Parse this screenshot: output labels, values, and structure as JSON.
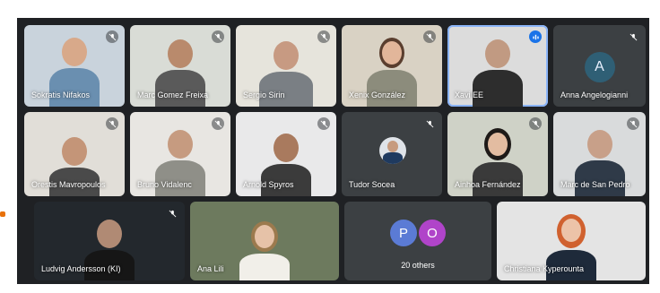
{
  "participants": [
    {
      "name": "Sokratis Nifakos"
    },
    {
      "name": "Marc Gomez Freixa"
    },
    {
      "name": "Sergio Sirin"
    },
    {
      "name": "Xenix González"
    },
    {
      "name": "Xavi EE"
    },
    {
      "name": "Anna Angelogianni",
      "initial": "A"
    },
    {
      "name": "Orestis Mavropoulos"
    },
    {
      "name": "Bruno Vidalenc"
    },
    {
      "name": "Arnold Spyros"
    },
    {
      "name": "Tudor Socea"
    },
    {
      "name": "Ainhoa Fernández"
    },
    {
      "name": "Marc de San Pedro"
    },
    {
      "name": "Ludvig Andersson (KI)"
    },
    {
      "name": "Ana Lili"
    },
    {
      "name": "Christiana Kyperounta"
    }
  ],
  "others": {
    "initials": [
      "P",
      "O"
    ],
    "label": "20 others",
    "colors": [
      "#5b7bd5",
      "#b044c9"
    ]
  },
  "colors": {
    "background": "#1f2124",
    "tile": "#3c4043",
    "speaking_border": "#8ab4f8",
    "active_mic": "#1a73e8"
  }
}
